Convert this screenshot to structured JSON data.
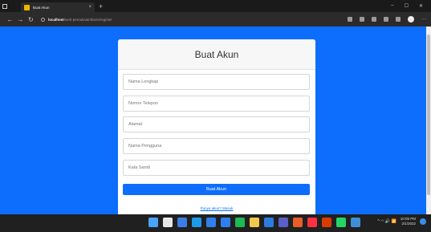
{
  "browser": {
    "tab_title": "Buat Akun",
    "url_host": "localhost",
    "url_path": "/web-pemakaian/kami/register",
    "nav": {
      "back": "←",
      "forward": "→",
      "reload": "↻"
    },
    "window_controls": {
      "minimize": "–",
      "maximize": "☐",
      "close": "✕"
    },
    "new_tab": "+",
    "tab_close": "×",
    "more": "···"
  },
  "form": {
    "title": "Buat Akun",
    "fields": [
      {
        "placeholder": "Nama Lengkap"
      },
      {
        "placeholder": "Nomor Telepon"
      },
      {
        "placeholder": "Alamat"
      },
      {
        "placeholder": "Nama Pengguna"
      },
      {
        "placeholder": "Kata Sandi"
      }
    ],
    "submit_label": "Buat Akun",
    "login_link": "Punya akun? Masuk"
  },
  "taskbar": {
    "apps": [
      "windows-start",
      "search",
      "file-explorer",
      "edge",
      "store",
      "mail",
      "spotify",
      "chrome",
      "vscode",
      "teams",
      "firefox",
      "opera",
      "office",
      "whatsapp",
      "photos"
    ],
    "app_colors": [
      "#4aa3ff",
      "#e6e6e6",
      "#3c7de6",
      "#1e9be8",
      "#2f80ed",
      "#2f80ed",
      "#1db954",
      "#f2c94c",
      "#2d7be0",
      "#5b5fc7",
      "#e85d2a",
      "#ff3040",
      "#d83b01",
      "#25d366",
      "#3f8fd6"
    ],
    "time": "10:05 PM",
    "date": "2/1/2022",
    "tray_icons": "^  ◠  🔊  📶"
  }
}
